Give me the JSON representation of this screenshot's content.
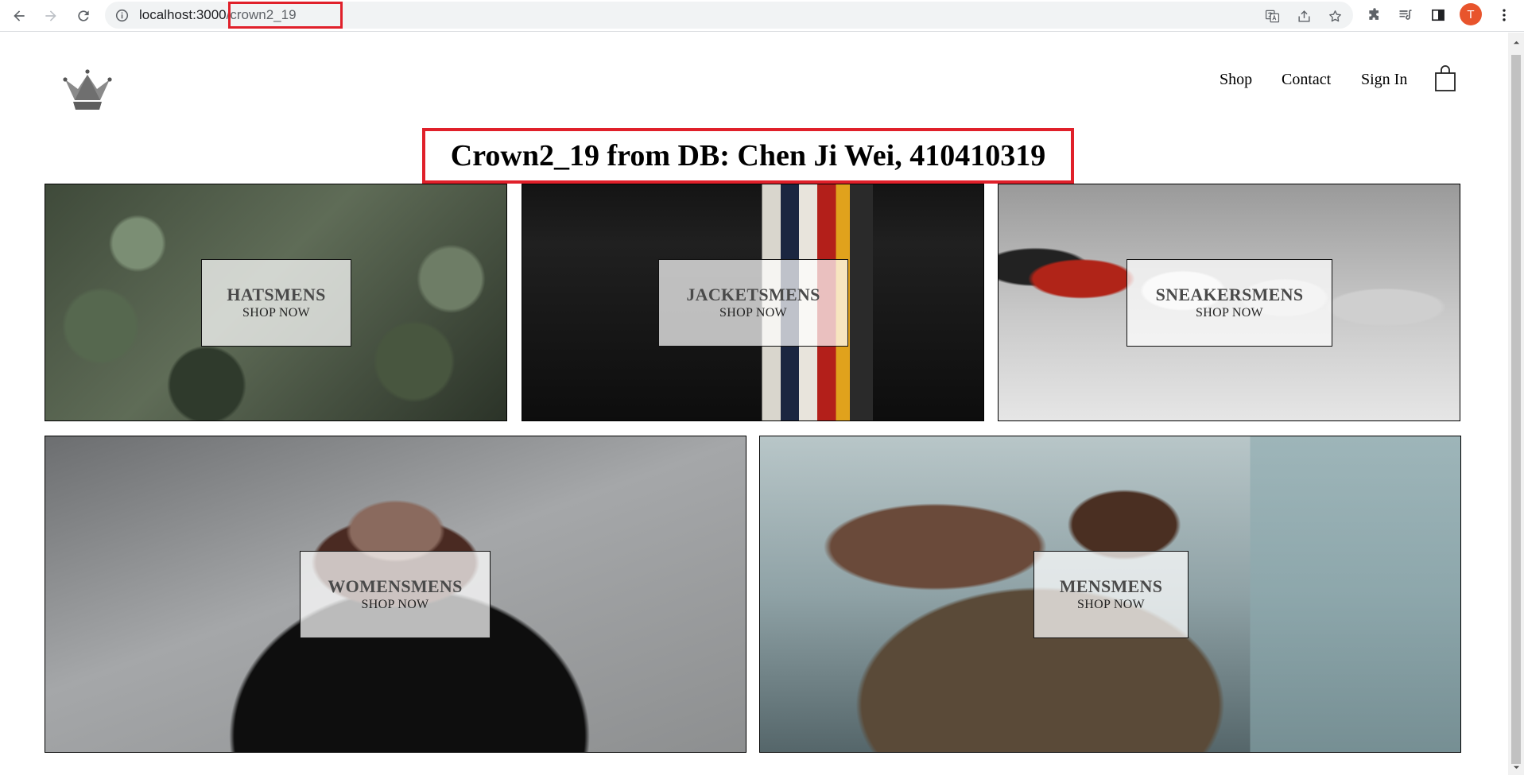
{
  "browser": {
    "url_host": "localhost:3000",
    "url_path": "/crown2_19",
    "profile_initial": "T"
  },
  "header": {
    "nav": {
      "shop": "Shop",
      "contact": "Contact",
      "sign_in": "Sign In"
    }
  },
  "page": {
    "title": "Crown2_19 from DB: Chen Ji Wei, 410410319"
  },
  "directory": [
    {
      "title": "HATSMENS",
      "subtitle": "SHOP NOW"
    },
    {
      "title": "JACKETSMENS",
      "subtitle": "SHOP NOW"
    },
    {
      "title": "SNEAKERSMENS",
      "subtitle": "SHOP NOW"
    },
    {
      "title": "WOMENSMENS",
      "subtitle": "SHOP NOW"
    },
    {
      "title": "MENSMENS",
      "subtitle": "SHOP NOW"
    }
  ],
  "colors": {
    "highlight": "#e0202a",
    "avatar": "#e8542c"
  }
}
